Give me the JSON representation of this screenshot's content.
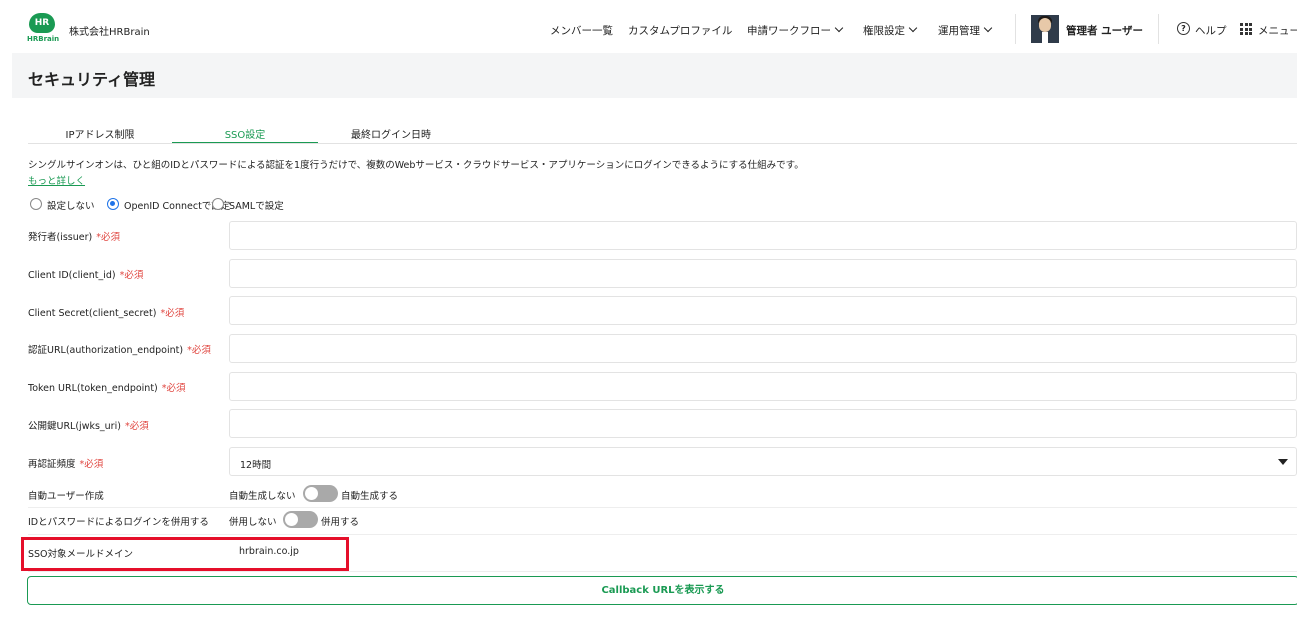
{
  "header": {
    "logo_text": "HR",
    "logo_brand": "HRBrain",
    "company": "株式会社HRBrain",
    "nav": [
      {
        "label": "メンバー一覧"
      },
      {
        "label": "カスタムプロファイル"
      },
      {
        "label": "申請ワークフロー"
      },
      {
        "label": "権限設定"
      },
      {
        "label": "運用管理"
      }
    ],
    "user_name": "管理者 ユーザー",
    "help_icon_glyph": "?",
    "help_label": "ヘルプ",
    "menu_label": "メニュー"
  },
  "page": {
    "title": "セキュリティ管理"
  },
  "tabs": [
    {
      "label": "IPアドレス制限",
      "active": false
    },
    {
      "label": "SSO設定",
      "active": true
    },
    {
      "label": "最終ログイン日時",
      "active": false
    }
  ],
  "description": "シングルサインオンは、ひと組のIDとパスワードによる認証を1度行うだけで、複数のWebサービス・クラウドサービス・アプリケーションにログインできるようにする仕組みです。",
  "more_link": "もっと詳しく",
  "sso_mode": {
    "options": [
      "設定しない",
      "OpenID Connectで設定",
      "SAMLで設定"
    ],
    "selected": "OpenID Connectで設定"
  },
  "form": {
    "required_mark": "*必須",
    "issuer_label": "発行者(issuer)",
    "issuer_value": "",
    "client_id_label": "Client ID(client_id)",
    "client_id_value": "",
    "client_secret_label": "Client Secret(client_secret)",
    "client_secret_value": "",
    "auth_url_label": "認証URL(authorization_endpoint)",
    "auth_url_value": "",
    "token_url_label": "Token URL(token_endpoint)",
    "token_url_value": "",
    "jwks_label": "公開鍵URL(jwks_uri)",
    "jwks_value": "",
    "reauth_label": "再認証頻度",
    "reauth_value": "12時間",
    "auto_user_label": "自動ユーザー作成",
    "auto_user_off": "自動生成しない",
    "auto_user_on": "自動生成する",
    "auto_user_enabled": false,
    "combined_login_label": "IDとパスワードによるログインを併用する",
    "combined_login_off": "併用しない",
    "combined_login_on": "併用する",
    "combined_login_enabled": false,
    "domain_label": "SSO対象メールドメイン",
    "domain_value": "hrbrain.co.jp"
  },
  "callback_button": "Callback URLを表示する",
  "colors": {
    "accent": "#1a9a53",
    "required": "#e0453f",
    "radio": "#1e73e8",
    "highlight": "#e50f2a"
  }
}
